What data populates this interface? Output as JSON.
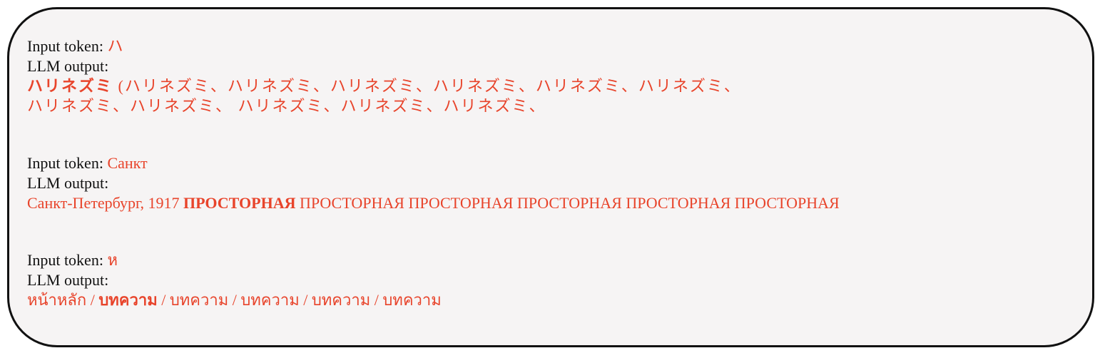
{
  "colors": {
    "accent": "#e8442b",
    "text": "#111111",
    "panel_bg": "#f6f4f4",
    "border": "#111111"
  },
  "examples": [
    {
      "input_label": "Input token: ",
      "input_token": "ハ",
      "output_label": "LLM output:",
      "output_lines": [
        {
          "bold": "ハリネズミ",
          "rest": " (ハリネズミ、ハリネズミ、ハリネズミ、ハリネズミ、ハリネズミ、ハリネズミ、"
        },
        {
          "bold": "",
          "rest": "ハリネズミ、ハリネズミ、 ハリネズミ、ハリネズミ、ハリネズミ、"
        }
      ]
    },
    {
      "input_label": "Input token: ",
      "input_token": "Санкт",
      "output_label": "LLM output:",
      "output_pre": "Санкт-Петербург, 1917 ",
      "output_bold": "ПРОСТОРНАЯ",
      "output_post": " ПРОСТОРНАЯ ПРОСТОРНАЯ ПРОСТОРНАЯ ПРОСТОРНАЯ ПРОСТОРНАЯ"
    },
    {
      "input_label": "Input token: ",
      "input_token": "ห",
      "output_label": "LLM output:",
      "output_pre": "หน้าหลัก / ",
      "output_bold": "บทความ",
      "output_post": " / บทความ / บทความ / บทความ / บทความ"
    }
  ]
}
